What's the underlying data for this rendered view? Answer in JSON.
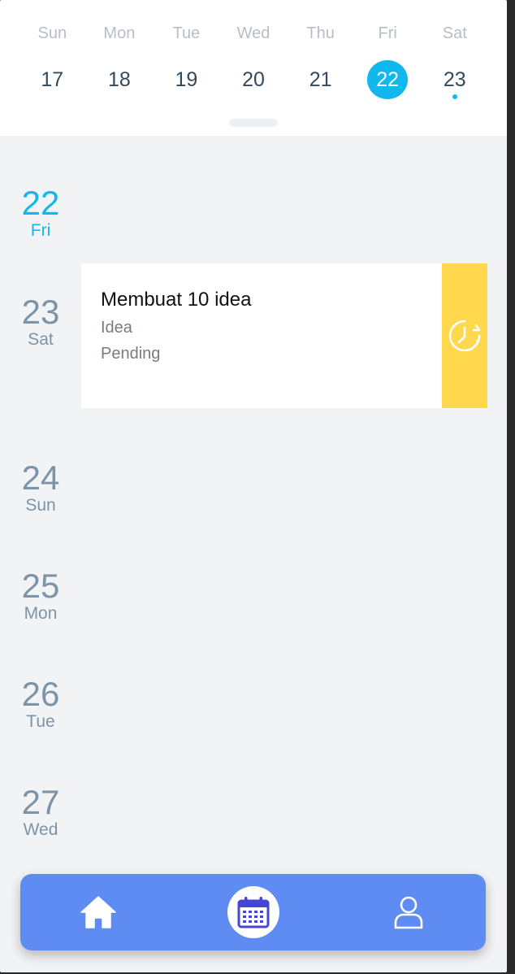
{
  "week": {
    "days": [
      {
        "dow": "Sun",
        "date": "17"
      },
      {
        "dow": "Mon",
        "date": "18"
      },
      {
        "dow": "Tue",
        "date": "19"
      },
      {
        "dow": "Wed",
        "date": "20"
      },
      {
        "dow": "Thu",
        "date": "21"
      },
      {
        "dow": "Fri",
        "date": "22"
      },
      {
        "dow": "Sat",
        "date": "23"
      }
    ],
    "selected_index": 5,
    "event_dot_index": 6
  },
  "agenda": [
    {
      "num": "22",
      "name": "Fri"
    },
    {
      "num": "23",
      "name": "Sat"
    },
    {
      "num": "24",
      "name": "Sun"
    },
    {
      "num": "25",
      "name": "Mon"
    },
    {
      "num": "26",
      "name": "Tue"
    },
    {
      "num": "27",
      "name": "Wed"
    }
  ],
  "event": {
    "title": "Membuat 10 idea",
    "category": "Idea",
    "status": "Pending",
    "status_icon": "pending-clock-icon"
  },
  "nav": {
    "items": [
      "home-icon",
      "calendar-icon",
      "user-icon"
    ],
    "active": "calendar-icon"
  },
  "colors": {
    "accent": "#12b7ee",
    "pending": "#ffd84e",
    "nav_bar": "#5e8cf3",
    "nav_active_icon": "#4545d6"
  }
}
